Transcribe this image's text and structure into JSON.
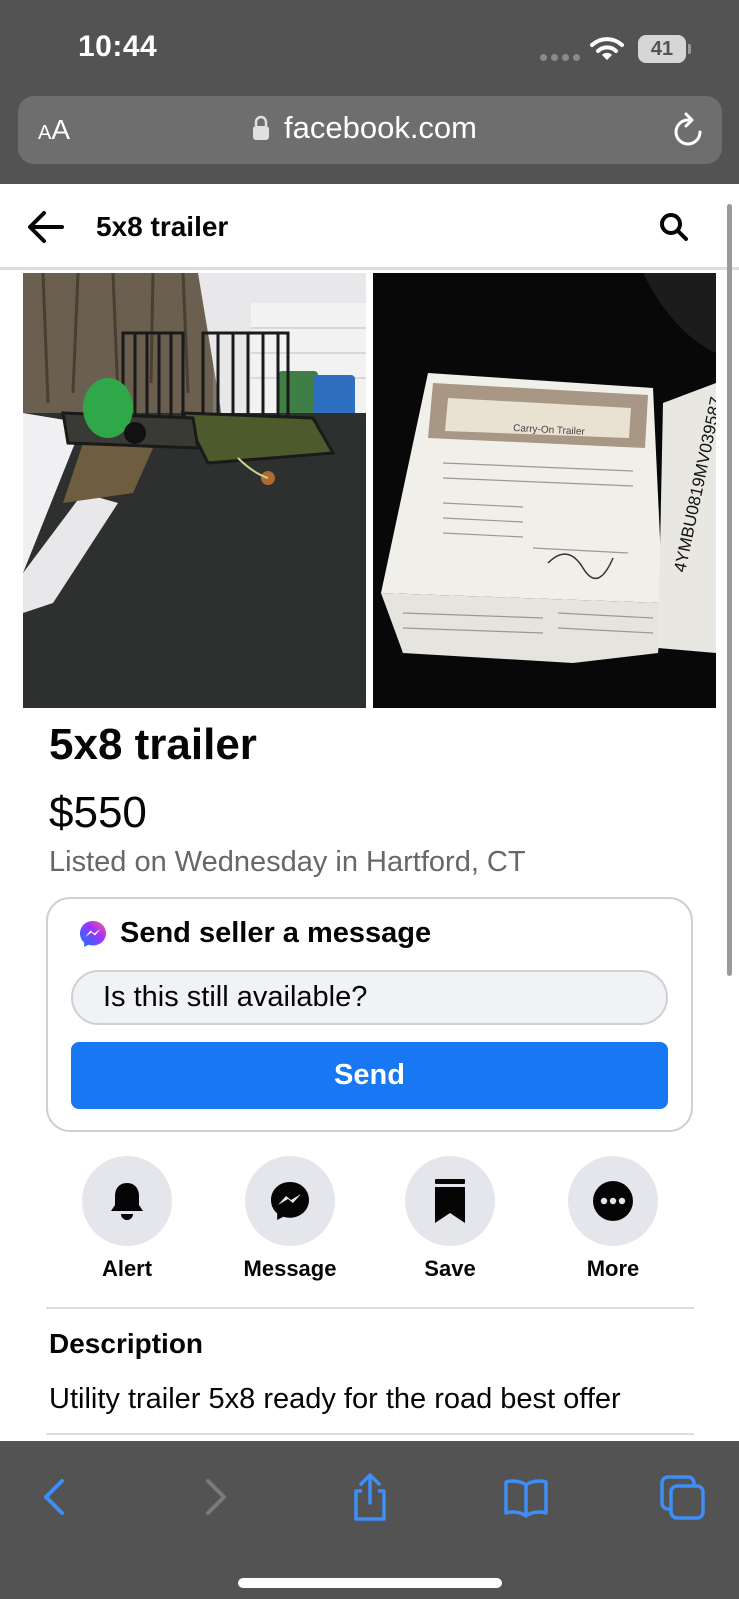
{
  "status_bar": {
    "time": "10:44",
    "battery": "41"
  },
  "browser": {
    "text_size_small": "A",
    "text_size_large": "A",
    "url": "facebook.com"
  },
  "header": {
    "title": "5x8 trailer"
  },
  "listing": {
    "title": "5x8 trailer",
    "price": "$550",
    "meta": "Listed on Wednesday in Hartford, CT",
    "photos": [
      {
        "id": "trailer-driveway"
      },
      {
        "id": "trailer-title-document",
        "doc_heading": "Carry-On Trailer",
        "vin": "4YMBU0819MV039587"
      }
    ]
  },
  "message_card": {
    "title": "Send seller a message",
    "input_value": "Is this still available?",
    "send_label": "Send"
  },
  "actions": [
    {
      "label": "Alert",
      "icon": "bell-icon"
    },
    {
      "label": "Message",
      "icon": "messenger-icon"
    },
    {
      "label": "Save",
      "icon": "bookmark-icon"
    },
    {
      "label": "More",
      "icon": "more-icon"
    }
  ],
  "description": {
    "heading": "Description",
    "text": "Utility trailer 5x8 ready for the road best offer"
  },
  "colors": {
    "accent": "#1877f2",
    "safari_chrome": "#535353",
    "safari_icons": "#3e8ef7",
    "secondary_text": "#65676b"
  }
}
